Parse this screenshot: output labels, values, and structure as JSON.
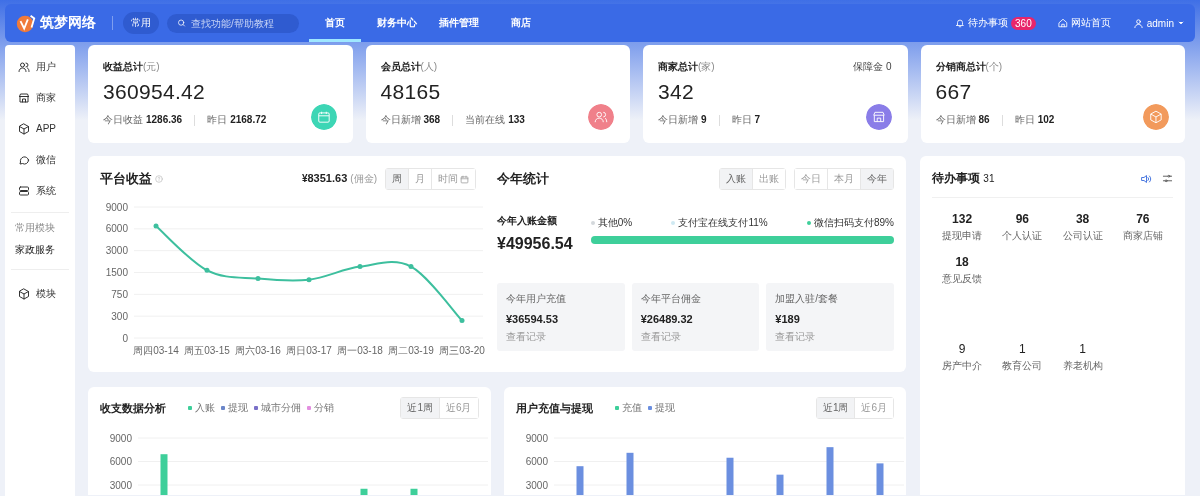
{
  "topbar": {
    "logo": "筑梦网络",
    "quick": "常用",
    "search": {
      "placeholder": "查找功能/帮助教程"
    },
    "nav": [
      {
        "label": "首页",
        "selected": true
      },
      {
        "label": "财务中心",
        "selected": false
      },
      {
        "label": "插件管理",
        "selected": false
      },
      {
        "label": "商店",
        "selected": false
      }
    ],
    "todo": {
      "label": "待办事项",
      "badge": "360"
    },
    "site": "网站首页",
    "user": "admin"
  },
  "sidebar": {
    "items": [
      "用户",
      "商家",
      "APP",
      "微信",
      "系统"
    ],
    "section_title": "常用模块",
    "section_items": [
      "家政服务"
    ],
    "extra_items": [
      "模块"
    ]
  },
  "stats": [
    {
      "title": "收益总计",
      "unit": "(元)",
      "value": "360954.42",
      "color": "#3dd6b5",
      "subs": [
        {
          "label": "今日收益",
          "value": "1286.36"
        },
        {
          "label": "昨日",
          "value": "2168.72"
        }
      ]
    },
    {
      "title": "会员总计",
      "unit": "(人)",
      "value": "48165",
      "color": "#f0808a",
      "subs": [
        {
          "label": "今日新增",
          "value": "368"
        },
        {
          "label": "当前在线",
          "value": "133"
        }
      ]
    },
    {
      "title": "商家总计",
      "unit": "(家)",
      "value": "342",
      "note": "保障金 0",
      "color": "#8a7de8",
      "subs": [
        {
          "label": "今日新增",
          "value": "9"
        },
        {
          "label": "昨日",
          "value": "7"
        }
      ]
    },
    {
      "title": "分销商总计",
      "unit": "(个)",
      "value": "667",
      "color": "#f29a5c",
      "subs": [
        {
          "label": "今日新增",
          "value": "86"
        },
        {
          "label": "昨日",
          "value": "102"
        }
      ]
    }
  ],
  "platform": {
    "title": "平台收益",
    "currency": "¥",
    "amount": "8351.63",
    "note": "(佣金)",
    "buttons": [
      {
        "label": "周",
        "selected": true
      },
      {
        "label": "月",
        "selected": false
      },
      {
        "label": "时间",
        "selected": false
      }
    ],
    "y_labels": [
      "9000",
      "6000",
      "3000",
      "1500",
      "750",
      "300",
      "0"
    ],
    "x_labels": [
      "周四03-14",
      "周五03-15",
      "周六03-16",
      "周日03-17",
      "周一03-18",
      "周二03-19",
      "周三03-20"
    ]
  },
  "year": {
    "title": "今年统计",
    "flow_buttons": [
      {
        "label": "入账",
        "selected": true
      },
      {
        "label": "出账",
        "selected": false
      }
    ],
    "period_buttons": [
      {
        "label": "今日",
        "selected": false
      },
      {
        "label": "本月",
        "selected": false
      },
      {
        "label": "今年",
        "selected": true
      }
    ],
    "amount_label": "今年入账金额",
    "amount": "¥49956.54",
    "legend": [
      {
        "label": "其他0%",
        "color": "#d4d8dc"
      },
      {
        "label": "支付宝在线支付11%",
        "color": "#cfe9f2"
      },
      {
        "label": "微信扫码支付89%",
        "color": "#3ecf9a"
      }
    ],
    "bar": {
      "level": 1
    },
    "cards": [
      {
        "label": "今年用户充值",
        "value": "¥36594.53",
        "link": "查看记录"
      },
      {
        "label": "今年平台佣金",
        "value": "¥26489.32",
        "link": "查看记录"
      },
      {
        "label": "加盟入驻/套餐",
        "value": "¥189",
        "link": "查看记录"
      }
    ]
  },
  "todo_panel": {
    "title": "待办事项",
    "count": "31",
    "items": [
      {
        "count": "132",
        "label": "提现申请"
      },
      {
        "count": "96",
        "label": "个人认证"
      },
      {
        "count": "38",
        "label": "公司认证"
      },
      {
        "count": "76",
        "label": "商家店铺"
      },
      {
        "count": "18",
        "label": "意见反馈"
      }
    ],
    "more_items": [
      {
        "count": "9",
        "label": "房产中介"
      },
      {
        "count": "1",
        "label": "教育公司"
      },
      {
        "count": "1",
        "label": "养老机构"
      }
    ]
  },
  "analysis": {
    "title": "收支数据分析",
    "legend": [
      {
        "label": "入账",
        "color": "#3ecf9a"
      },
      {
        "label": "提现",
        "color": "#6b86c9"
      },
      {
        "label": "城市分佣",
        "color": "#7a70c8"
      },
      {
        "label": "分销",
        "color": "#e38fe0"
      }
    ],
    "buttons": [
      {
        "label": "近1周",
        "selected": true
      },
      {
        "label": "近6月",
        "selected": false
      }
    ],
    "y_labels": [
      "9000",
      "6000",
      "3000"
    ]
  },
  "recharge": {
    "title": "用户充值与提现",
    "legend": [
      {
        "label": "充值",
        "color": "#3ecf9a"
      },
      {
        "label": "提现",
        "color": "#6b8fe0"
      }
    ],
    "buttons": [
      {
        "label": "近1周",
        "selected": true
      },
      {
        "label": "近6月",
        "selected": false
      }
    ],
    "y_labels": [
      "9000",
      "6000",
      "3000"
    ]
  }
}
